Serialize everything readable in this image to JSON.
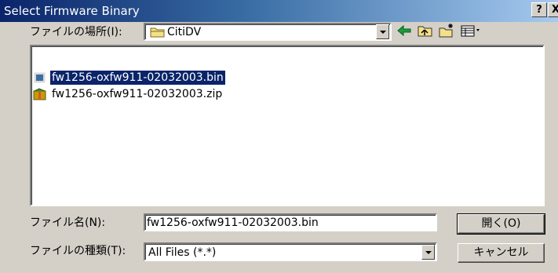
{
  "window": {
    "title": "Select Firmware Binary",
    "help_label": "?",
    "close_label": "X"
  },
  "look_in": {
    "label": "ファイルの場所(I):",
    "value": "CitiDV"
  },
  "toolbar": {
    "back_icon": "back-arrow-icon",
    "up_icon": "up-folder-icon",
    "new_folder_icon": "new-folder-icon",
    "view_icon": "view-menu-icon"
  },
  "files": [
    {
      "name": "fw1256-oxfw911-02032003.bin",
      "selected": true,
      "icon": "bin-file-icon"
    },
    {
      "name": "fw1256-oxfw911-02032003.zip",
      "selected": false,
      "icon": "zip-file-icon"
    }
  ],
  "filename": {
    "label": "ファイル名(N):",
    "value": "fw1256-oxfw911-02032003.bin"
  },
  "filetype": {
    "label": "ファイルの種類(T):",
    "value": "All Files (*.*)"
  },
  "buttons": {
    "open": "開く(O)",
    "cancel": "キャンセル"
  },
  "colors": {
    "selection": "#0a246a",
    "dialog_face": "#d4d0c8"
  }
}
